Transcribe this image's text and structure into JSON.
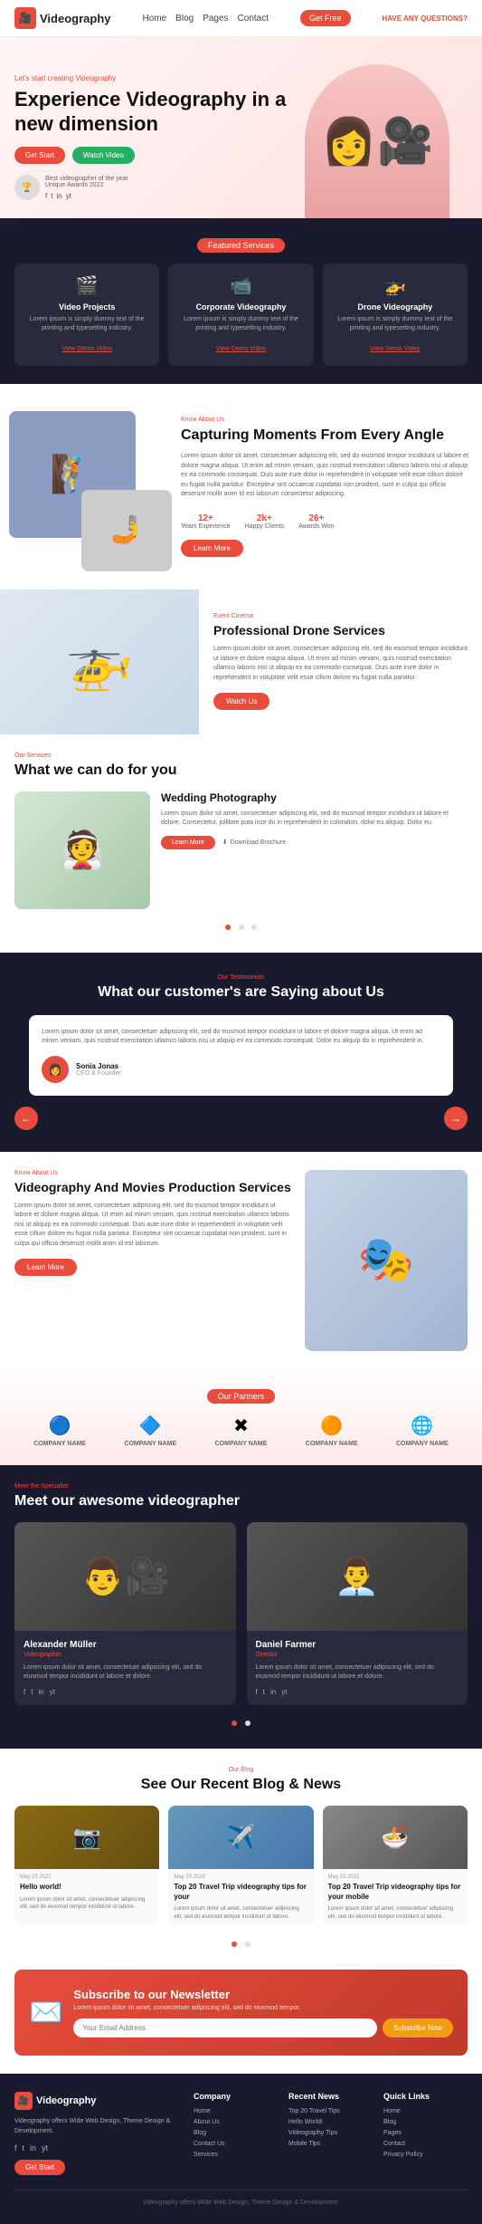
{
  "nav": {
    "logo": "Videography",
    "links": [
      "Home",
      "Blog",
      "Pages",
      "Contact"
    ],
    "cta": "Get Free",
    "contact": "HAVE ANY QUESTIONS?"
  },
  "hero": {
    "tagline": "Let's start creating Videography",
    "title": "Experience Videography in a new dimension",
    "btn_primary": "Get Start",
    "btn_secondary": "Watch Video",
    "badge_text": "Best videographer of the year",
    "badge_sub": "Unique Awards 2022",
    "social": [
      "f",
      "t",
      "in",
      "yt"
    ]
  },
  "featured": {
    "badge": "Featured Services",
    "services": [
      {
        "icon": "🎬",
        "title": "Video Projects",
        "desc": "Lorem ipsum is simply dummy text of the printing and typesetting industry.",
        "link": "View Demo Video"
      },
      {
        "icon": "📹",
        "title": "Corporate Videography",
        "desc": "Lorem ipsum is simply dummy text of the printing and typesetting industry.",
        "link": "View Demo Video"
      },
      {
        "icon": "🚁",
        "title": "Drone Videography",
        "desc": "Lorem ipsum is simply dummy text of the printing and typesetting industry.",
        "link": "View Demo Video"
      }
    ]
  },
  "about": {
    "label": "Know About Us",
    "title": "Capturing Moments From Every Angle",
    "desc": "Lorem ipsum dolor sit amet, consectetuer adipiscing elit, sed do eiusmod tempor incididunt ut labore et dolore magna aliqua. Ut enim ad minim veniam, quis nostrud exercitation ullamco laboris nisi ut aliquip ex ea commodo consequat. Duis aute irure dolor in reprehenderit in voluptate velit esse cillum dolore eu fugiat nulla pariatur. Excepteur sint occaecat cupidatat non proident, sunt in culpa qui officia deserunt mollit anim id est laborum consectetur adipiscing.",
    "stats": [
      {
        "number": "12",
        "suffix": "+",
        "label": "Years Experience"
      },
      {
        "number": "2k",
        "suffix": "+",
        "label": "Happy Clients"
      },
      {
        "number": "26",
        "suffix": "+",
        "label": "Awards Won"
      }
    ],
    "btn": "Learn More"
  },
  "drone": {
    "label": "Event Cinema",
    "title": "Professional Drone Services",
    "desc": "Lorem ipsum dolor sit amet, consectetuer adipiscing elit, sed do eiusmod tempor incididunt ut labore et dolore magna aliqua. Ut enim ad minim veniam, quis nostrud exercitation ullamco laboris nisi ut aliquip ex ea commodo consequat. Duis aute irure dolor in reprehenderit in voluptate velit esse cillum dolore eu fugiat nulla pariatur.",
    "btn": "Watch Us"
  },
  "our_services": {
    "label": "Our Services",
    "title": "What we can do for you",
    "service": {
      "title": "Wedding Photography",
      "desc": "Lorem ipsum dolor sit amet, consectetuer adipiscing elit, sed do eiusmod tempor incididunt ut labore et dolore. Consectetur, jollibee puta inze do in reprehenderit in coloration, dolor eu aliquip. Dolor eu.",
      "btn": "Learn More",
      "download": "Download Brochure"
    }
  },
  "testimonials": {
    "label": "Our Testimonials",
    "title": "What our customer's are Saying about Us",
    "text": "Lorem ipsum dolor sit amet, consectetuer adipiscing elit, sed do eiusmod tempor incididunt ut labore et dolore magna aliqua. Ut enim ad minim veniam, quis nostrud exercitation ullamco laboris nisi ut aliquip ex ea commodo consequat. Dolor eu aliquip do in reprehenderit in.",
    "author_name": "Sonia Jonas",
    "author_title": "CEO & Founder",
    "nav_prev": "←",
    "nav_next": "→"
  },
  "movies": {
    "label": "Know About Us",
    "title": "Videography And Movies Production Services",
    "desc": "Lorem ipsum dolor sit amet, consectetuer adipiscing elit, sed do eiusmod tempor incididunt ut labore et dolore magna aliqua. Ut enim ad minim veniam, quis nostrud exercitation ullamco laboris nisi ut aliquip ex ea commodo consequat. Duis aute irure dolor in reprehenderit in voluptate velit esse cillum dolore eu fugiat nulla pariatur. Excepteur sint occaecat cupidatat non proident, sunt in culpa qui officia deserunt mollit anim id est laborum.",
    "btn": "Learn More"
  },
  "partners": {
    "badge": "Our Partners",
    "logos": [
      {
        "icon": "🔵",
        "name": "COMPANY NAME"
      },
      {
        "icon": "🔷",
        "name": "COMPANY NAME"
      },
      {
        "icon": "✖",
        "name": "COMPANY NAME"
      },
      {
        "icon": "🟠",
        "name": "COMPANY NAME"
      },
      {
        "icon": "🌐",
        "name": "COMPANY NAME"
      }
    ]
  },
  "team": {
    "label": "Meet the Specialist",
    "title": "Meet our awesome videographer",
    "members": [
      {
        "icon": "👨‍🎥",
        "name": "Alexander Müller",
        "role": "Videographer",
        "desc": "Lorem ipsum dolor sit amet, consectetuer adipiscing elit, sed do eiusmod tempor incididunt ut labore et dolore.",
        "social": [
          "f",
          "t",
          "in",
          "yt"
        ]
      },
      {
        "icon": "👨‍💼",
        "name": "Daniel Farmer",
        "role": "Director",
        "desc": "Lorem ipsum dolor sit amet, consectetuer adipiscing elit, sed do eiusmod tempor incididunt ut labore et dolore.",
        "social": [
          "f",
          "t",
          "in",
          "yt"
        ]
      }
    ]
  },
  "blog": {
    "label": "Our Blog",
    "title": "See Our Recent Blog & News",
    "posts": [
      {
        "img_class": "img1",
        "emoji": "📷",
        "date": "May 23 2022",
        "title": "Hello world!",
        "desc": "Lorem ipsum dolor sit amet, consectetuer adipiscing elit, sed do eiusmod tempor incididunt ut labore."
      },
      {
        "img_class": "img2",
        "emoji": "✈",
        "date": "May 23 2022",
        "title": "Top 20 Travel Trip videography tips for your",
        "desc": "Lorem ipsum dolor sit amet, consectetuer adipiscing elit, sed do eiusmod tempor incididunt ut labore."
      },
      {
        "img_class": "img3",
        "emoji": "🍜",
        "date": "May 23 2022",
        "title": "Top 20 Travel Trip videography tips for your mobile",
        "desc": "Lorem ipsum dolor sit amet, consectetuer adipiscing elit, sed do eiusmod tempor incididunt ut labore."
      }
    ]
  },
  "newsletter": {
    "title": "Subscribe to our Newsletter",
    "desc": "Lorem ipsum dolor sit amet, consectetuer adipiscing elit, sed do eiusmod tempor.",
    "placeholder": "Your Email Address",
    "btn": "Subscribe Now"
  },
  "footer": {
    "logo": "Videography",
    "desc": "Videography offers Wide Web Design, Theme Design & Development.",
    "social": [
      "f",
      "t",
      "in",
      "yt"
    ],
    "columns": [
      {
        "title": "Company",
        "links": [
          "Home",
          "About Us",
          "Blog",
          "Contact Us",
          "Services"
        ]
      },
      {
        "title": "Recent News",
        "links": [
          "Top 20 Travel Tips",
          "Hello World!",
          "Videography Tips",
          "Mobile Tips"
        ]
      },
      {
        "title": "Quick Links",
        "links": [
          "Home",
          "Blog",
          "Pages",
          "Contact",
          "Privacy Policy"
        ]
      }
    ],
    "copyright": "Videography offers Wide Web Design, Theme Design & Development.",
    "cta": "Get Start"
  }
}
